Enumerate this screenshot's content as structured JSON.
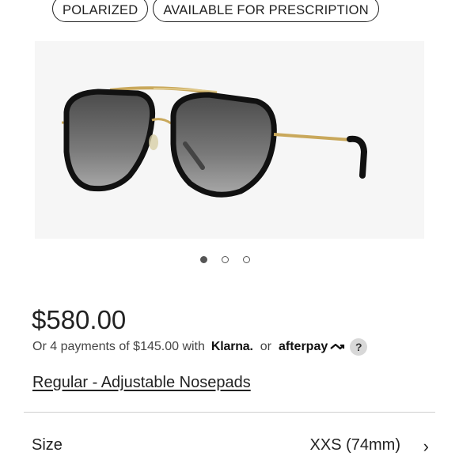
{
  "tags": [
    "POLARIZED",
    "AVAILABLE FOR PRESCRIPTION"
  ],
  "product_image": {
    "alt": "aviator-sunglasses",
    "carousel_count": 3,
    "active_index": 0
  },
  "price": "$580.00",
  "payments": {
    "text": "Or 4 payments of $145.00 with",
    "klarna": "Klarna.",
    "or": "or",
    "afterpay": "afterpay",
    "help": "?"
  },
  "lens_option": "Regular - Adjustable Nosepads",
  "size": {
    "label": "Size",
    "value": "XXS (74mm)",
    "chevron": "›"
  },
  "colors": {
    "text": "#222222",
    "hero_bg": "#f6f6f6",
    "frame_gold": "#c9a85b",
    "lens_gray": "#6f6f6f"
  }
}
